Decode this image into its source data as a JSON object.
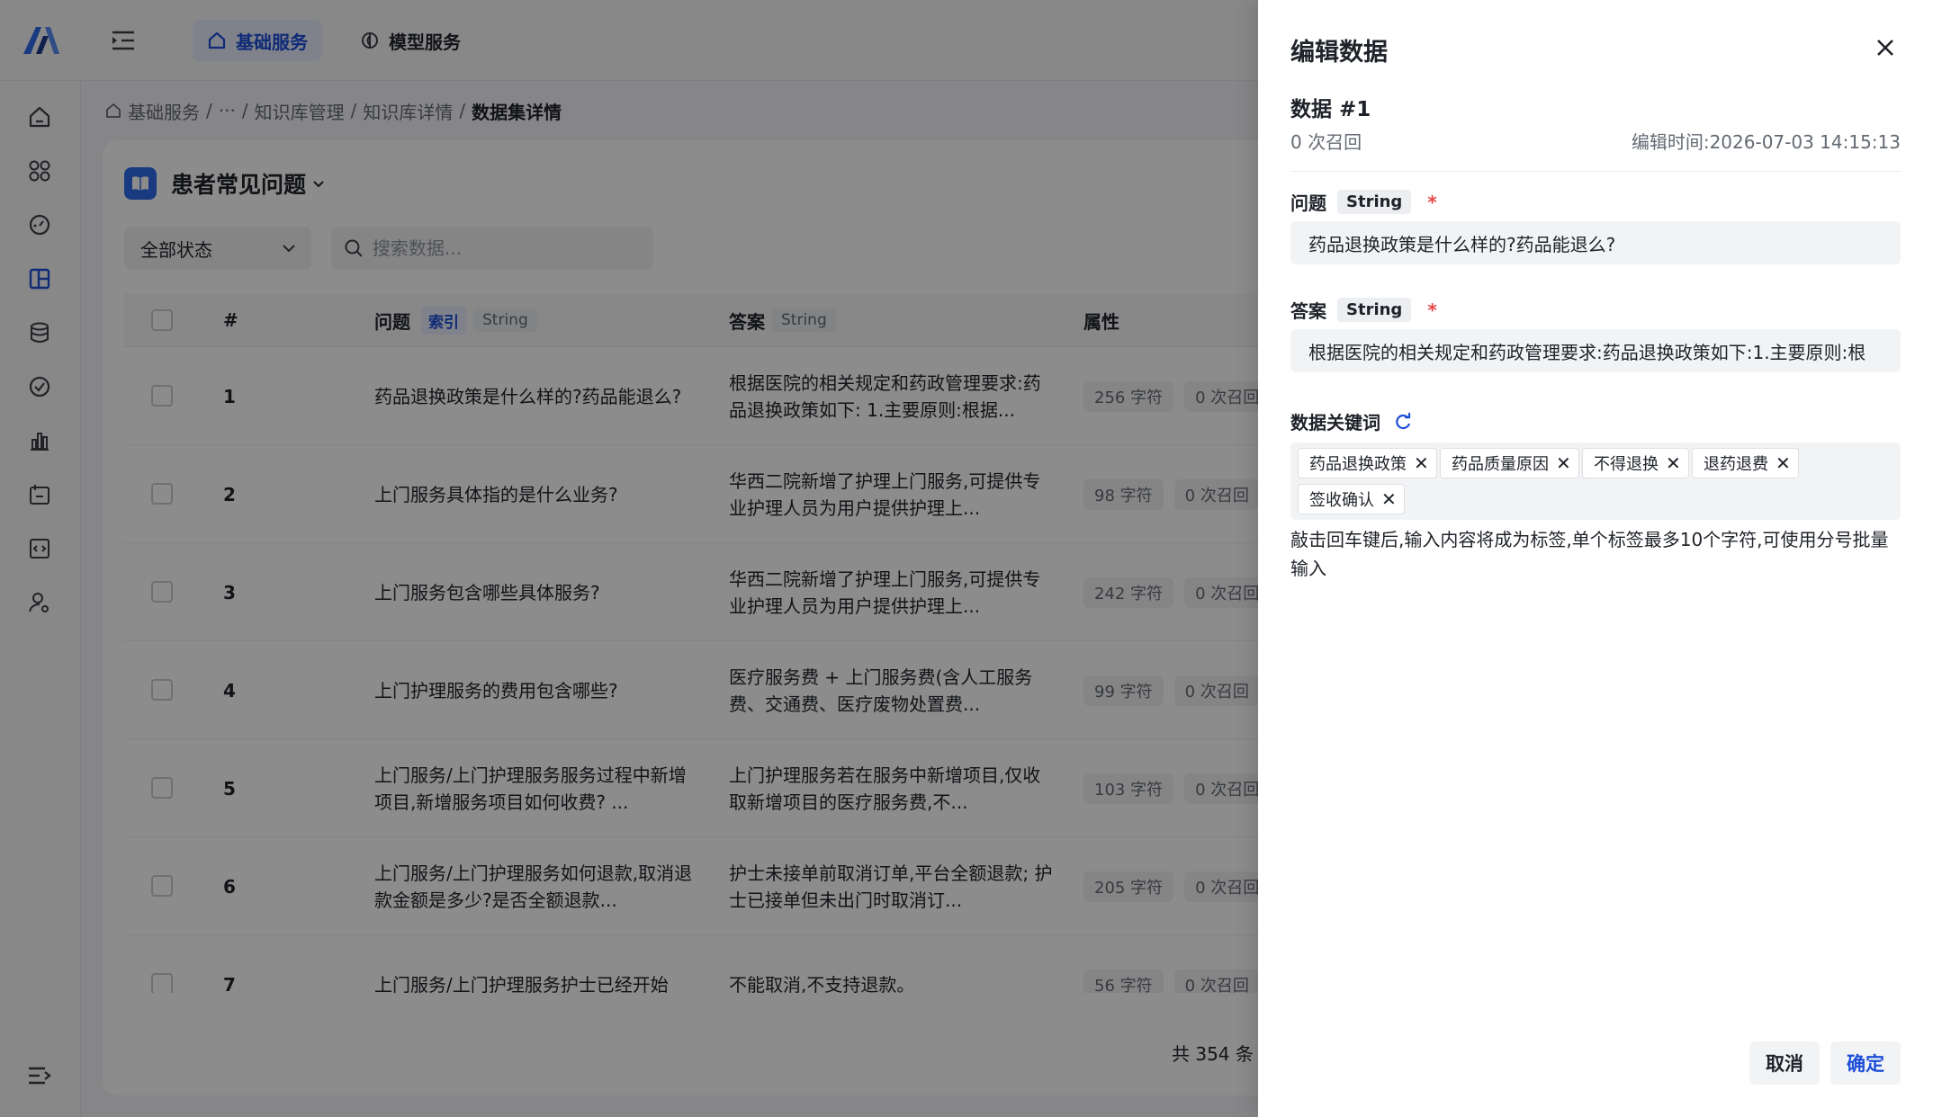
{
  "header": {
    "tabs": [
      {
        "label": "基础服务",
        "active": true
      },
      {
        "label": "模型服务",
        "active": false
      }
    ]
  },
  "breadcrumb": {
    "items": [
      "基础服务",
      "···",
      "知识库管理",
      "知识库详情"
    ],
    "separator": "/",
    "current": "数据集详情"
  },
  "dataset": {
    "title": "患者常见问题",
    "status_select": "全部状态",
    "search_placeholder": "搜索数据..."
  },
  "table": {
    "columns": {
      "index": "#",
      "question": "问题",
      "question_index_tag": "索引",
      "question_type": "String",
      "answer": "答案",
      "answer_type": "String",
      "attrs": "属性"
    },
    "rows": [
      {
        "index": "1",
        "question": "药品退换政策是什么样的?药品能退么?",
        "answer": "根据医院的相关规定和药政管理要求:药品退换政策如下: 1.主要原则:根据...",
        "chars": "256 字符",
        "recall": "0 次召回"
      },
      {
        "index": "2",
        "question": "上门服务具体指的是什么业务?",
        "answer": "华西二院新增了护理上门服务,可提供专业护理人员为用户提供护理上...",
        "chars": "98 字符",
        "recall": "0 次召回"
      },
      {
        "index": "3",
        "question": "上门服务包含哪些具体服务?",
        "answer": "华西二院新增了护理上门服务,可提供专业护理人员为用户提供护理上...",
        "chars": "242 字符",
        "recall": "0 次召回"
      },
      {
        "index": "4",
        "question": "上门护理服务的费用包含哪些?",
        "answer": "医疗服务费 + 上门服务费(含人工服务费、交通费、医疗废物处置费...",
        "chars": "99 字符",
        "recall": "0 次召回"
      },
      {
        "index": "5",
        "question": "上门服务/上门护理服务服务过程中新增项目,新增服务项目如何收费? ...",
        "answer": "上门护理服务若在服务中新增项目,仅收取新增项目的医疗服务费,不...",
        "chars": "103 字符",
        "recall": "0 次召回"
      },
      {
        "index": "6",
        "question": "上门服务/上门护理服务如何退款,取消退款金额是多少?是否全额退款...",
        "answer": "护士未接单前取消订单,平台全额退款; 护士已接单但未出门时取消订...",
        "chars": "205 字符",
        "recall": "0 次召回"
      },
      {
        "index": "7",
        "question": "上门服务/上门护理服务护士已经开始",
        "answer": "不能取消,不支持退款。",
        "chars": "56 字符",
        "recall": "0 次召回"
      }
    ],
    "total": "共 354 条"
  },
  "drawer": {
    "title": "编辑数据",
    "subtitle": "数据 #1",
    "recall": "0 次召回",
    "edit_time": "编辑时间:2026-07-03 14:15:13",
    "question_label": "问题",
    "question_type": "String",
    "question_value": "药品退换政策是什么样的?药品能退么?",
    "answer_label": "答案",
    "answer_type": "String",
    "answer_value": "根据医院的相关规定和药政管理要求:药品退换政策如下:1.主要原则:根",
    "required_mark": "*",
    "keywords_label": "数据关键词",
    "keywords": [
      "药品退换政策",
      "药品质量原因",
      "不得退换",
      "退药退费",
      "签收确认"
    ],
    "keywords_hint": "敲击回车键后,输入内容将成为标签,单个标签最多10个字符,可使用分号批量输入",
    "cancel_label": "取消",
    "confirm_label": "确定"
  },
  "colors": {
    "accent": "#1d4ed8",
    "required": "#e54545"
  }
}
